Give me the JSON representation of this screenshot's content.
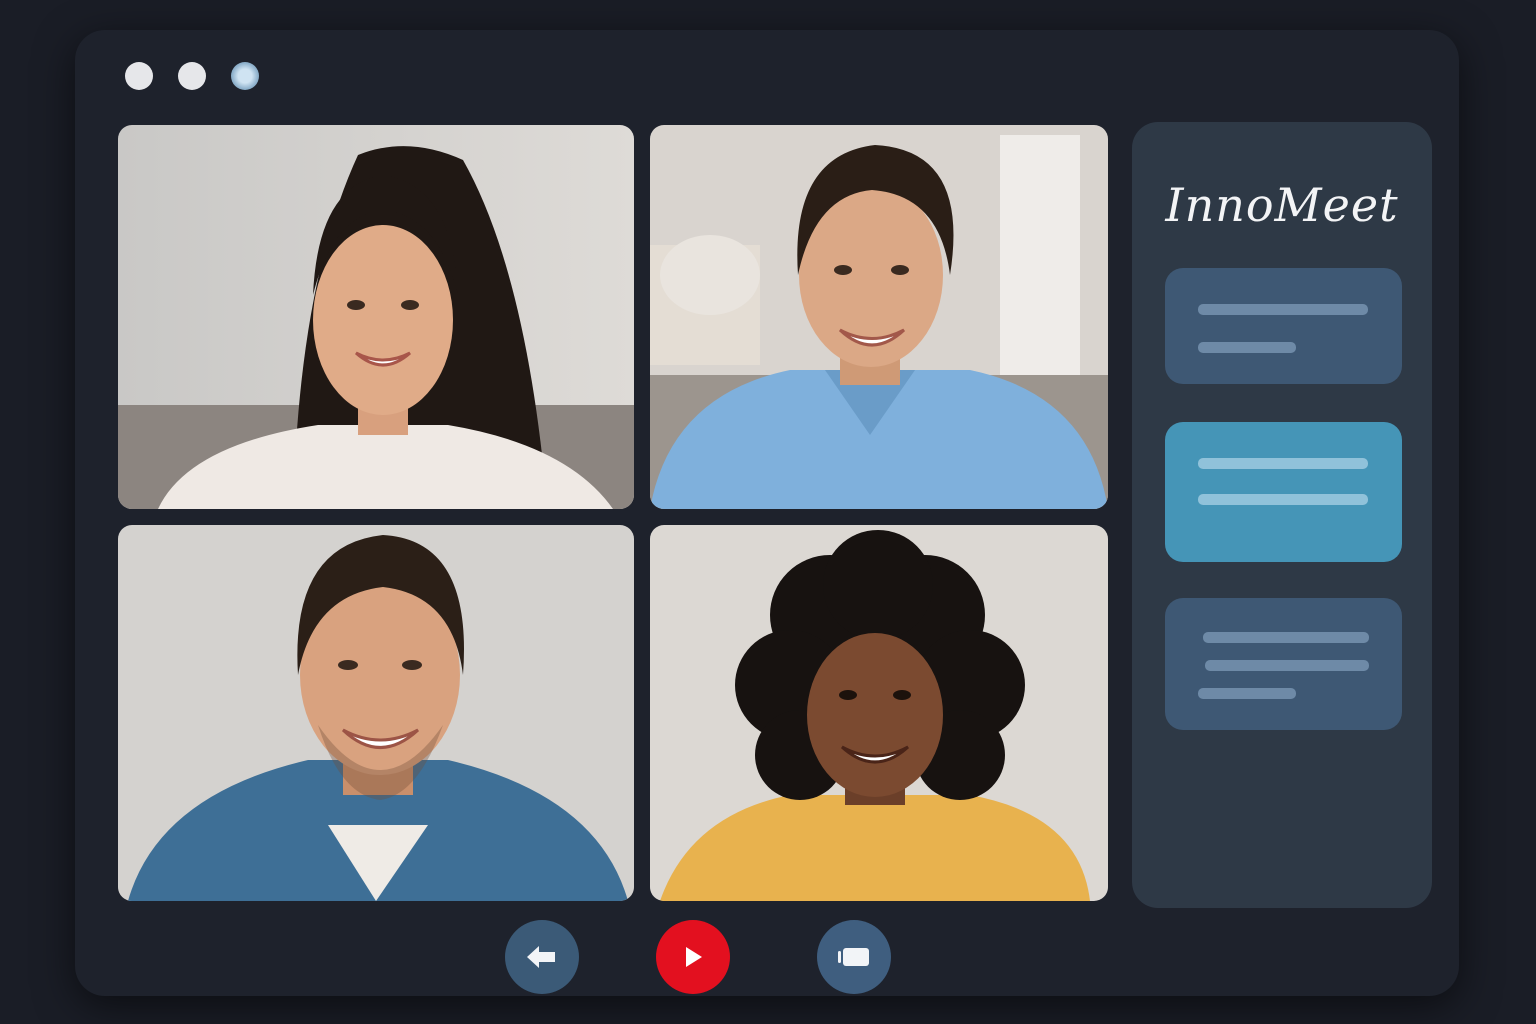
{
  "app": {
    "name": "InnoMeet"
  },
  "window_controls": [
    "close-dot",
    "minimize-dot",
    "maximize-dot"
  ],
  "participants": [
    {
      "name_hidden": true,
      "shirt_color": "#efe9e4",
      "hair_color": "#201814"
    },
    {
      "name_hidden": true,
      "shirt_color": "#7fb0dc",
      "hair_color": "#2a1e16"
    },
    {
      "name_hidden": true,
      "shirt_color": "#3e6f96",
      "hair_color": "#2b1f17"
    },
    {
      "name_hidden": true,
      "shirt_color": "#e8b24e",
      "hair_color": "#171210"
    }
  ],
  "sidebar": {
    "cards": [
      {
        "active": false
      },
      {
        "active": true
      },
      {
        "active": false
      }
    ]
  },
  "controls": [
    {
      "icon": "leave-arrow-icon",
      "color": "#3b5a77"
    },
    {
      "icon": "play-icon",
      "color": "#e3101f"
    },
    {
      "icon": "screen-share-icon",
      "color": "#3f5e7f"
    }
  ],
  "colors": {
    "background": "#1a1d26",
    "window": "#1e222c",
    "sidebar": "#2e3946",
    "card": "#3e5874",
    "card_active": "#4595b7",
    "record": "#e3101f"
  }
}
